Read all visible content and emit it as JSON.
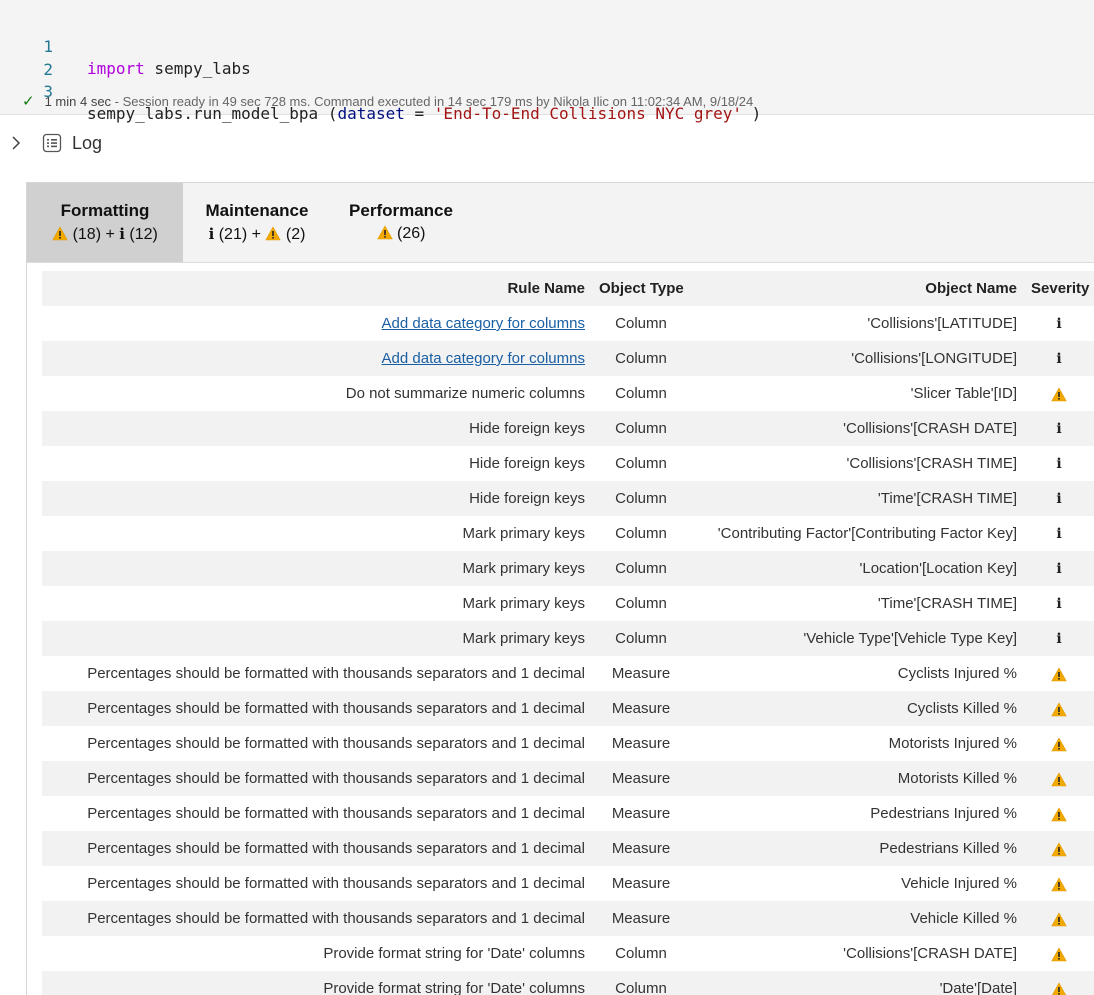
{
  "code": {
    "lines": [
      {
        "num": "1",
        "kw": "import",
        "rest": " sempy_labs"
      },
      {
        "num": "2"
      },
      {
        "num": "3",
        "func": "sempy_labs.run_model_bpa (",
        "param": "dataset",
        "eq": " = ",
        "str": "'End-To-End Collisions NYC grey'",
        "close": " )"
      }
    ]
  },
  "status": {
    "duration": "1 min 4 sec",
    "message": " - Session ready in 49 sec 728 ms. Command executed in 14 sec 179 ms by Nikola Ilic on 11:02:34 AM, 9/18/24"
  },
  "log": {
    "label": "Log"
  },
  "tabs": [
    {
      "title": "Formatting",
      "warn_count": "(18)",
      "sep": "+",
      "info_count": "(12)"
    },
    {
      "title": "Maintenance",
      "info_count": "(21)",
      "sep": "+",
      "warn_count": "(2)"
    },
    {
      "title": "Performance",
      "warn_count": "(26)"
    }
  ],
  "table": {
    "headers": {
      "rule": "Rule Name",
      "type": "Object Type",
      "object": "Object Name",
      "severity": "Severity"
    },
    "rows": [
      {
        "rule": "Add data category for columns",
        "link": true,
        "type": "Column",
        "object": "'Collisions'[LATITUDE]",
        "severity": "info"
      },
      {
        "rule": "Add data category for columns",
        "link": true,
        "type": "Column",
        "object": "'Collisions'[LONGITUDE]",
        "severity": "info"
      },
      {
        "rule": "Do not summarize numeric columns",
        "link": false,
        "type": "Column",
        "object": "'Slicer Table'[ID]",
        "severity": "warning"
      },
      {
        "rule": "Hide foreign keys",
        "link": false,
        "type": "Column",
        "object": "'Collisions'[CRASH DATE]",
        "severity": "info"
      },
      {
        "rule": "Hide foreign keys",
        "link": false,
        "type": "Column",
        "object": "'Collisions'[CRASH TIME]",
        "severity": "info"
      },
      {
        "rule": "Hide foreign keys",
        "link": false,
        "type": "Column",
        "object": "'Time'[CRASH TIME]",
        "severity": "info"
      },
      {
        "rule": "Mark primary keys",
        "link": false,
        "type": "Column",
        "object": "'Contributing Factor'[Contributing Factor Key]",
        "severity": "info"
      },
      {
        "rule": "Mark primary keys",
        "link": false,
        "type": "Column",
        "object": "'Location'[Location Key]",
        "severity": "info"
      },
      {
        "rule": "Mark primary keys",
        "link": false,
        "type": "Column",
        "object": "'Time'[CRASH TIME]",
        "severity": "info"
      },
      {
        "rule": "Mark primary keys",
        "link": false,
        "type": "Column",
        "object": "'Vehicle Type'[Vehicle Type Key]",
        "severity": "info"
      },
      {
        "rule": "Percentages should be formatted with thousands separators and 1 decimal",
        "link": false,
        "type": "Measure",
        "object": "Cyclists Injured %",
        "severity": "warning"
      },
      {
        "rule": "Percentages should be formatted with thousands separators and 1 decimal",
        "link": false,
        "type": "Measure",
        "object": "Cyclists Killed %",
        "severity": "warning"
      },
      {
        "rule": "Percentages should be formatted with thousands separators and 1 decimal",
        "link": false,
        "type": "Measure",
        "object": "Motorists Injured %",
        "severity": "warning"
      },
      {
        "rule": "Percentages should be formatted with thousands separators and 1 decimal",
        "link": false,
        "type": "Measure",
        "object": "Motorists Killed %",
        "severity": "warning"
      },
      {
        "rule": "Percentages should be formatted with thousands separators and 1 decimal",
        "link": false,
        "type": "Measure",
        "object": "Pedestrians Injured %",
        "severity": "warning"
      },
      {
        "rule": "Percentages should be formatted with thousands separators and 1 decimal",
        "link": false,
        "type": "Measure",
        "object": "Pedestrians Killed %",
        "severity": "warning"
      },
      {
        "rule": "Percentages should be formatted with thousands separators and 1 decimal",
        "link": false,
        "type": "Measure",
        "object": "Vehicle Injured %",
        "severity": "warning"
      },
      {
        "rule": "Percentages should be formatted with thousands separators and 1 decimal",
        "link": false,
        "type": "Measure",
        "object": "Vehicle Killed %",
        "severity": "warning"
      },
      {
        "rule": "Provide format string for 'Date' columns",
        "link": false,
        "type": "Column",
        "object": "'Collisions'[CRASH DATE]",
        "severity": "warning"
      },
      {
        "rule": "Provide format string for 'Date' columns",
        "link": false,
        "type": "Column",
        "object": "'Date'[Date]",
        "severity": "warning"
      }
    ]
  },
  "colors": {
    "warning": "#f2a900",
    "info": "#222222",
    "link": "#1a5fa3",
    "active_tab": "#d0d0d0"
  }
}
